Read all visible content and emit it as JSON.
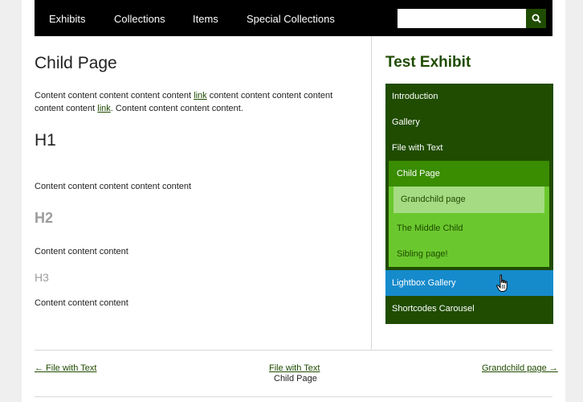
{
  "topnav": {
    "links": [
      "Exhibits",
      "Collections",
      "Items",
      "Special Collections"
    ],
    "search_value": "",
    "search_icon": "search-icon"
  },
  "main": {
    "title": "Child Page",
    "para1_a": "Content content content content content ",
    "para1_link1": "link",
    "para1_b": " content content content content content content ",
    "para1_link2": "link",
    "para1_c": ". Content content content content.",
    "h1": "H1",
    "para2": "Content content content content content",
    "h2": "H2",
    "para3": "Content content content",
    "h3": "H3",
    "para4": "Content content content"
  },
  "sidebar": {
    "title": "Test Exhibit",
    "items": [
      "Introduction",
      "Gallery",
      "File with Text"
    ],
    "child_page": "Child Page",
    "grandchild": "Grandchild page",
    "middle_child": "The Middle Child",
    "sibling": "Sibling page!",
    "lightbox": "Lightbox Gallery",
    "shortcodes": "Shortcodes Carousel",
    "colors": {
      "dark_green": "#1f4c00",
      "mid_green": "#3a8c00",
      "light_green": "#6ac82e",
      "pale_green": "#a5db82",
      "hover_blue": "#168bcc"
    }
  },
  "footer": {
    "prev": "← File with Text",
    "up": "File with Text",
    "current": "Child Page",
    "next": "Grandchild page →"
  }
}
